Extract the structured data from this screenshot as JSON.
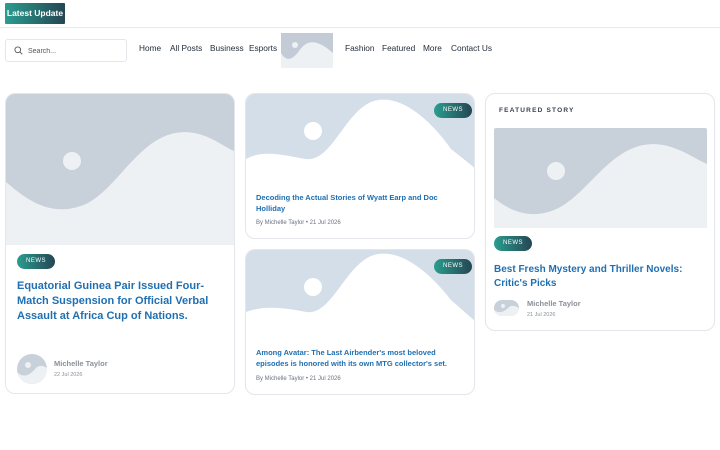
{
  "header": {
    "latest_update": "Latest Update"
  },
  "search": {
    "placeholder": "Search..."
  },
  "nav": {
    "items": [
      "Home",
      "All Posts",
      "Business",
      "Esports",
      "Fashion",
      "Featured",
      "More",
      "Contact Us"
    ]
  },
  "main_story": {
    "badge": "NEWS",
    "title": "Equatorial Guinea Pair Issued Four-Match Suspension for Official Verbal Assault at Africa Cup of Nations.",
    "author": "Michelle Taylor",
    "date": "22 Jul 2026"
  },
  "middle_stories": [
    {
      "badge": "NEWS",
      "title": "Decoding the Actual Stories of Wyatt Earp and Doc Holliday",
      "meta": "By Michelle Taylor  • 21 Jul 2026"
    },
    {
      "badge": "NEWS",
      "title": "Among Avatar: The Last Airbender's most beloved episodes is honored with its own MTG collector's set.",
      "meta": "By Michelle Taylor  • 21 Jul 2026"
    }
  ],
  "featured": {
    "label": "FEATURED STORY",
    "badge": "NEWS",
    "title": "Best Fresh Mystery and Thriller Novels: Critic's Picks",
    "author": "Michelle Taylor",
    "date": "21 Jul 2026"
  },
  "colors": {
    "accent_start": "#2a9d8f",
    "accent_end": "#264653",
    "title_blue": "#1f6fb2",
    "placeholder_bg": "#d4dee8",
    "placeholder_hill": "#ffffff"
  },
  "icons": {
    "search": "search-icon",
    "image_placeholder": "image-placeholder-icon"
  }
}
